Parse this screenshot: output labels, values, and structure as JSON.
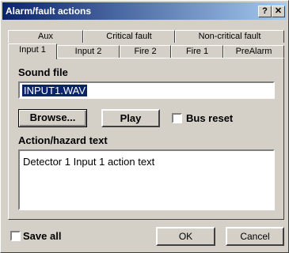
{
  "window": {
    "title": "Alarm/fault actions",
    "help_button": "?",
    "close_button": "✕"
  },
  "tabs_row_back": [
    "Aux",
    "Critical fault",
    "Non-critical fault"
  ],
  "tabs_row_front": [
    "Input 1",
    "Input 2",
    "Fire 2",
    "Fire 1",
    "PreAlarm"
  ],
  "sound": {
    "label": "Sound file",
    "value": "INPUT1.WAV"
  },
  "buttons": {
    "browse": "Browse...",
    "play": "Play",
    "ok": "OK",
    "cancel": "Cancel"
  },
  "checkboxes": {
    "bus_reset": "Bus reset",
    "save_all": "Save all"
  },
  "action": {
    "label": "Action/hazard text",
    "value": "Detector 1 Input 1 action text"
  }
}
